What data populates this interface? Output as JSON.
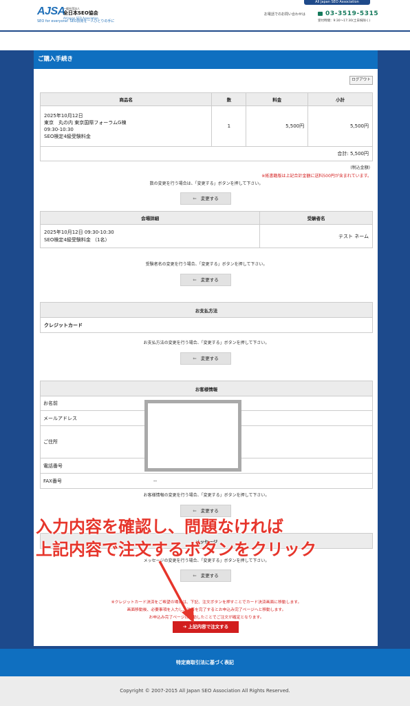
{
  "header": {
    "logo_mark": "AJSA",
    "logo_line1": "一般社団法人",
    "logo_line2": "全日本SEO協会",
    "logo_line3": "All Japan SEO Association",
    "tagline": "SEO for everyone! SEO技術を一人ひとりの手に",
    "top_tag": "All Japan SEO Association",
    "contact_label": "お電話でのお問い合わせは",
    "phone": "03-3519-5315",
    "hours": "受付時間：9:30～17:30(土日祝除く)"
  },
  "panel": {
    "title": "ご購入手続き",
    "logout_label": "ログアウト"
  },
  "order_table": {
    "headers": [
      "商品名",
      "数",
      "料金",
      "小計"
    ],
    "row": {
      "item_line1": "2025年10月12日",
      "item_line2": "東京　丸の内 東京国際フォーラムG棟",
      "item_line3": "09:30-10:30",
      "item_line4": "SEO検定4級受験料金",
      "qty": "1",
      "price": "5,500円",
      "subtotal": "5,500円"
    },
    "total": "合計: 5,500円",
    "tax_note": "(税込金額)",
    "shipping_note": "※紙書籍版は上記合計金額に送料500円が含まれています。",
    "change_note": "数の変更を行う場合は、「変更する」ボタンを押して下さい。"
  },
  "change_button_label": "変更する",
  "venue_table": {
    "headers": [
      "会場詳細",
      "受験者名"
    ],
    "detail_line1": "2025年10月12日 09:30-10:30",
    "detail_line2": "SEO検定4級受験料金 （1名）",
    "examinee": "テスト ネーム",
    "change_note": "受験者名の変更を行う場合、「変更する」ボタンを押して下さい。"
  },
  "payment": {
    "header": "お支払方法",
    "method": "クレジットカード",
    "change_note": "お支払方法の変更を行う場合、「変更する」ボタンを押して下さい。"
  },
  "customer": {
    "header": "お客様情報",
    "fields": [
      "お名前",
      "メールアドレス",
      "ご住所",
      "電話番号",
      "FAX番号"
    ],
    "fax_value": "--",
    "change_note": "お客様情報の変更を行う場合、「変更する」ボタンを押して下さい。"
  },
  "message": {
    "header": "メッセージ",
    "change_note": "メッセージの変更を行う場合、「変更する」ボタンを押して下さい。"
  },
  "red_notes": [
    "※クレジットカード決済をご希望の場合は、下記、注文ボタンを押すことでカード決済画面に移動します。",
    "画面移動後、必要事項を入力し、決済を完了するとお申込み完了ページへと移動します。",
    "お申込み完了ページに移動したことでご注文が確定となります。"
  ],
  "order_button_label": "上記内容で注文する",
  "overlay": {
    "line1": "入力内容を確認し、問題なければ",
    "line2": "上記内容で注文するボタンをクリック"
  },
  "footer": {
    "tokushoho": "特定商取引法に基づく表記",
    "copyright": "Copyright © 2007-2015 All Japan SEO Association All Rights Reserved."
  },
  "colors": {
    "brand_blue": "#0f6fc0",
    "navy": "#1d4a8c",
    "accent_red": "#d21e1e",
    "phone_green": "#14795b"
  }
}
